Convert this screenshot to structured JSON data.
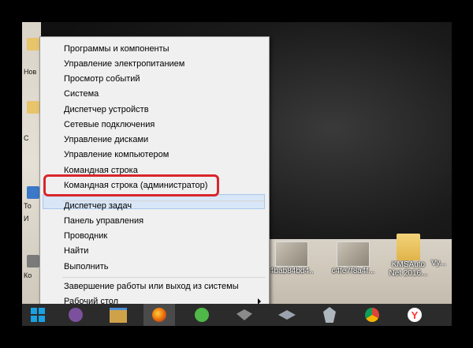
{
  "menu": {
    "items": [
      "Программы и компоненты",
      "Управление электропитанием",
      "Просмотр событий",
      "Система",
      "Диспетчер устройств",
      "Сетевые подключения",
      "Управление дисками",
      "Управление компьютером",
      "Командная строка",
      "Командная строка (администратор)",
      "Диспетчер задач",
      "Панель управления",
      "Проводник",
      "Найти",
      "Выполнить",
      "Завершение работы или выход из системы",
      "Рабочий стол"
    ],
    "highlighted_index": 9
  },
  "desktop": {
    "left_labels": [
      "Нов",
      "С",
      "То",
      "И",
      "Ко"
    ],
    "icons": [
      {
        "label": "4bab84bd4..."
      },
      {
        "label": "c4fe7f8a4f..."
      },
      {
        "label": "KMSAuto Net 2016..."
      },
      {
        "label": "Vy..."
      }
    ]
  },
  "taskbar": {
    "items": [
      "start-button",
      "viber-icon",
      "explorer-icon",
      "firefox-icon",
      "utorrent-icon",
      "world-of-tanks-icon",
      "world-of-warplanes-icon",
      "world-of-warships-icon",
      "chrome-icon",
      "yandex-browser-icon"
    ],
    "active_index": 3
  },
  "colors": {
    "highlight_bg": "#d8e6f7",
    "annotation_red": "#d9262c",
    "taskbar_bg": "#2b2b2b"
  }
}
